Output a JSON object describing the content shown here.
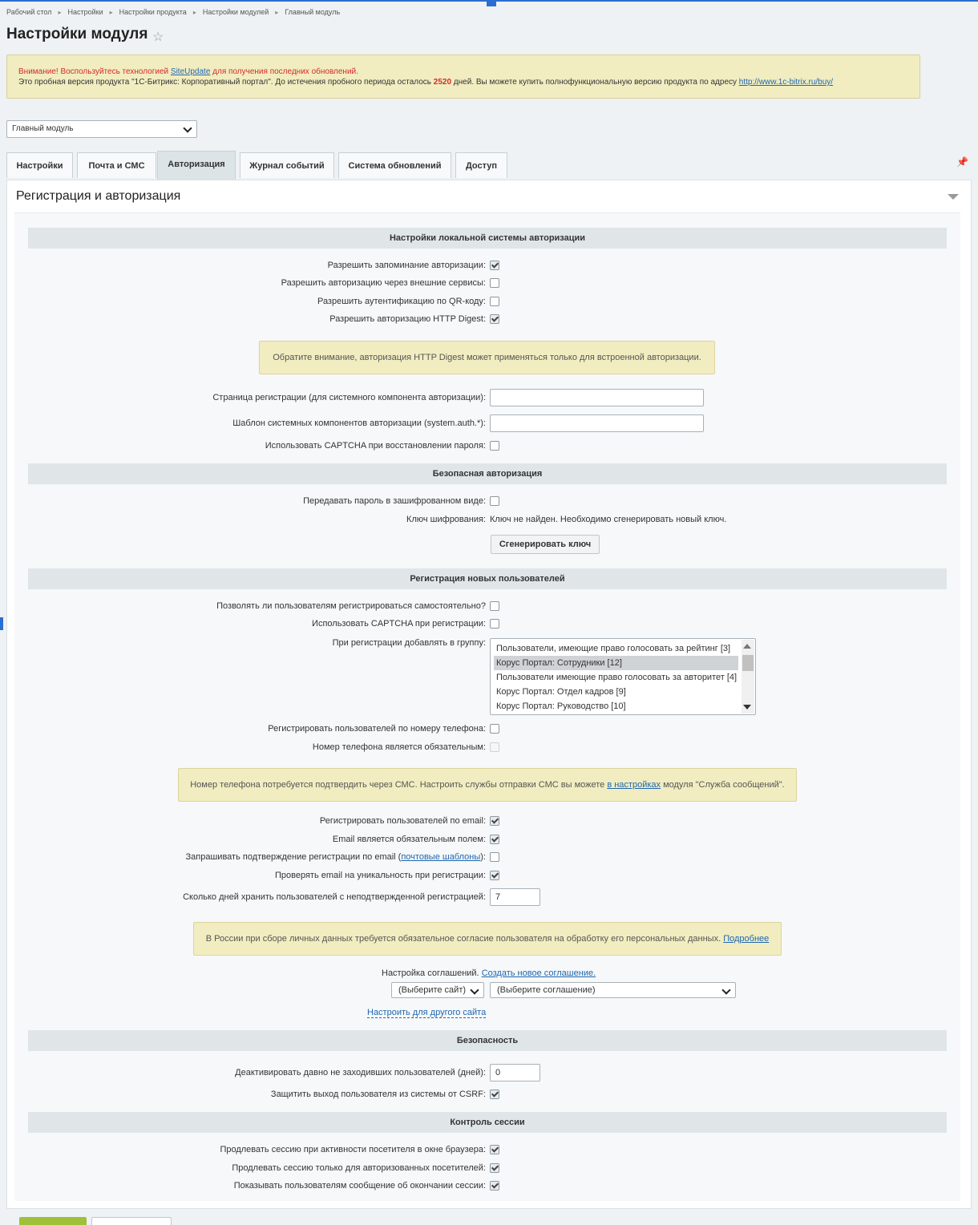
{
  "breadcrumb": [
    "Рабочий стол",
    "Настройки",
    "Настройки продукта",
    "Настройки модулей",
    "Главный модуль"
  ],
  "page_title": "Настройки модуля",
  "notice": {
    "line1_prefix": "Внимание! Воспользуйтесь технологией ",
    "line1_link": "SiteUpdate",
    "line1_suffix": " для получения последних обновлений.",
    "line2_prefix": "Это пробная версия продукта \"1С-Битрикс: Корпоративный портал\". До истечения пробного периода осталось ",
    "line2_days": "2520",
    "line2_middle": " дней. Вы можете купить полнофункциональную версию продукта по адресу ",
    "line2_link": "http://www.1c-bitrix.ru/buy/"
  },
  "module_select": "Главный модуль",
  "tabs": [
    "Настройки",
    "Почта и СМС",
    "Авторизация",
    "Журнал событий",
    "Система обновлений",
    "Доступ"
  ],
  "section_title": "Регистрация и авторизация",
  "local_auth": {
    "heading": "Настройки локальной системы авторизации",
    "remember": "Разрешить запоминание авторизации:",
    "external": "Разрешить авторизацию через внешние сервисы:",
    "qr": "Разрешить аутентификацию по QR-коду:",
    "digest": "Разрешить авторизацию HTTP Digest:",
    "digest_hint": "Обратите внимание, авторизация HTTP Digest может применяться только для встроенной авторизации.",
    "reg_page": "Страница регистрации (для системного компонента авторизации):",
    "template": "Шаблон системных компонентов авторизации (system.auth.*):",
    "captcha_restore": "Использовать CAPTCHA при восстановлении пароля:"
  },
  "secure_auth": {
    "heading": "Безопасная авторизация",
    "encrypted": "Передавать пароль в зашифрованном виде:",
    "key_label": "Ключ шифрования:",
    "key_value": "Ключ не найден. Необходимо сгенерировать новый ключ.",
    "generate_button": "Сгенерировать ключ"
  },
  "registration": {
    "heading": "Регистрация новых пользователей",
    "self_register": "Позволять ли пользователям регистрироваться самостоятельно?",
    "captcha_reg": "Использовать CAPTCHA при регистрации:",
    "group_label": "При регистрации добавлять в группу:",
    "groups": [
      "Пользователи, имеющие право голосовать за рейтинг [3]",
      "Корус Портал: Сотрудники [12]",
      "Пользователи имеющие право голосовать за авторитет [4]",
      "Корус Портал: Отдел кадров [9]",
      "Корус Портал: Руководство [10]"
    ],
    "phone_reg": "Регистрировать пользователей по номеру телефона:",
    "phone_required": "Номер телефона является обязательным:",
    "sms_hint_prefix": "Номер телефона потребуется подтвердить через СМС. Настроить службы отправки СМС вы можете ",
    "sms_hint_link": "в настройках",
    "sms_hint_suffix": " модуля \"Служба сообщений\".",
    "email_reg": "Регистрировать пользователей по email:",
    "email_required": "Email является обязательным полем:",
    "email_confirm_prefix": "Запрашивать подтверждение регистрации по email (",
    "email_confirm_link": "почтовые шаблоны",
    "email_confirm_suffix": "):",
    "email_unique": "Проверять email на уникальность при регистрации:",
    "keep_days_label": "Сколько дней хранить пользователей с неподтвержденной регистрацией:",
    "keep_days_value": "7",
    "gdpr_hint_prefix": "В России при сборе личных данных требуется обязательное согласие пользователя на обработку его персональных данных. ",
    "gdpr_hint_link": "Подробнее",
    "agreement_label": "Настройка соглашений.",
    "agreement_create": "Создать новое соглашение.",
    "site_select": "(Выберите сайт)",
    "agreement_select": "(Выберите соглашение)",
    "other_site_link": "Настроить для другого сайта"
  },
  "security": {
    "heading": "Безопасность",
    "deactivate_label": "Деактивировать давно не заходивших пользователей (дней):",
    "deactivate_value": "0",
    "csrf": "Защитить выход пользователя из системы от CSRF:"
  },
  "session": {
    "heading": "Контроль сессии",
    "extend_active": "Продлевать сессию при активности посетителя в окне браузера:",
    "extend_auth": "Продлевать сессию только для авторизованных посетителей:",
    "show_message": "Показывать пользователям сообщение об окончании сессии:"
  }
}
